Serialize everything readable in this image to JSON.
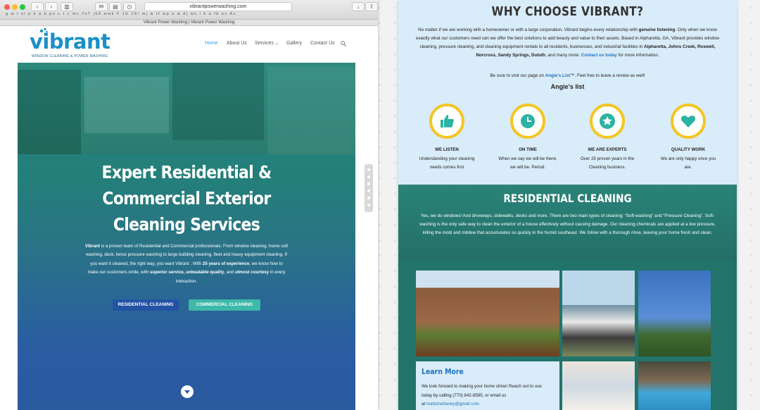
{
  "browser": {
    "url": "vibrantpowerwashing.com",
    "tab_title": "Vibrant Power Washing | Vibrant Power Washing",
    "bookmarks": "g  w  l  ol  p  k  a  b  po  c  t  c  mc  ToT  jb6  wwk  F  JS  JS!  mj  w  tf  wp  a  w  dj  wn  l  k  a  fb  ev  Az"
  },
  "site": {
    "logo": {
      "name": "vibrant",
      "tagline": "WINDOW CLEANING & POWER WASHING"
    },
    "nav": {
      "home": "Home",
      "about": "About Us",
      "services": "Services",
      "gallery": "Gallery",
      "contact": "Contact Us"
    },
    "hero": {
      "title_line1": "Expert Residential &",
      "title_line2": "Commercial Exterior",
      "title_line3": "Cleaning Services",
      "body_pre": "Vibrant",
      "body_1": " is a proven team of Residential and Commercial professionals. From window cleaning, home soft washing, deck, fence pressure washing to large building cleaning, fleet and heavy equipment cleaning. If you want it cleaned, the right way, you want Vibrant . With ",
      "body_years": "25 years of experience",
      "body_2": ", we know how to make our customers smile, with ",
      "body_service": "superior service, unbeatable quality",
      "body_3": ", and ",
      "body_courtesy": "utmost courtesy",
      "body_4": " in every interaction.",
      "btn_residential": "RESIDENTIAL CLEANING",
      "btn_commercial": "COMMERCIAL CLEANING"
    }
  },
  "why": {
    "title": "WHY CHOOSE VIBRANT?",
    "p1": "No matter if we are working with a homeowner or with a large corporation, Vibrant begins every relationship with ",
    "p1b": "genuine listening",
    "p2": ". Only when we know exactly what our customers need can we offer the best solutions to add beauty and value to their assets. Based in Alpharetta, GA, Vibrant provides window cleaning, pressure cleaning, and cleaning equipment rentals to all residents, businesses, and industrial facilities in ",
    "p2b": "Alpharetta, Johns Creek, Roswell, Norcross, Sandy Springs, Duluth",
    "p3": ", and many more. ",
    "p3link": "Contact us today",
    "p4": " for more information.",
    "angies_pre": "Be sure to visit our page on ",
    "angies_link": "Angie's List",
    "angies_post": "™. Feel free to leave a review as well!",
    "angies_logo": "Angie's list",
    "features": [
      {
        "icon": "thumbs-up-icon",
        "title": "WE LISTEN",
        "l1": "Understanding your cleaning",
        "l2": "needs comes first"
      },
      {
        "icon": "clock-icon",
        "title": "ON TIME",
        "l1": "When we say we will be there,",
        "l2": "we will be. Period."
      },
      {
        "icon": "star-icon",
        "title": "WE ARE EXPERTS",
        "l1": "Over 25 proven years in the",
        "l2": "Cleaning business."
      },
      {
        "icon": "heart-icon",
        "title": "QUALITY WORK",
        "l1": "We are only happy once you",
        "l2": "are."
      }
    ]
  },
  "residential": {
    "title": "RESIDENTIAL CLEANING",
    "body": "Yes, we do windows! And driveways, sidewalks, decks and more. There are two main types of cleaning: “Soft-washing” and “Pressure Cleaning”. Soft-washing is the only safe way to clean the exterior of a house effectively without causing damage. Our cleaning chemicals are applied at a low pressure, killing the mold and mildew that accumulates so quickly in the humid southeast. We follow with a thorough rinse, leaving your home fresh and clean."
  },
  "learn": {
    "title": "Learn More",
    "l1": "We look forward to making your home shine! Reach out to use",
    "l2": "today by calling (770) 842-8595, or email us",
    "l3pre": "at ",
    "email": "mattsmahaney@gmail.com"
  },
  "colors": {
    "brand_blue": "#1b90c5",
    "accent_yellow": "#f4c524",
    "teal": "#2a8378",
    "link": "#1e73be"
  }
}
